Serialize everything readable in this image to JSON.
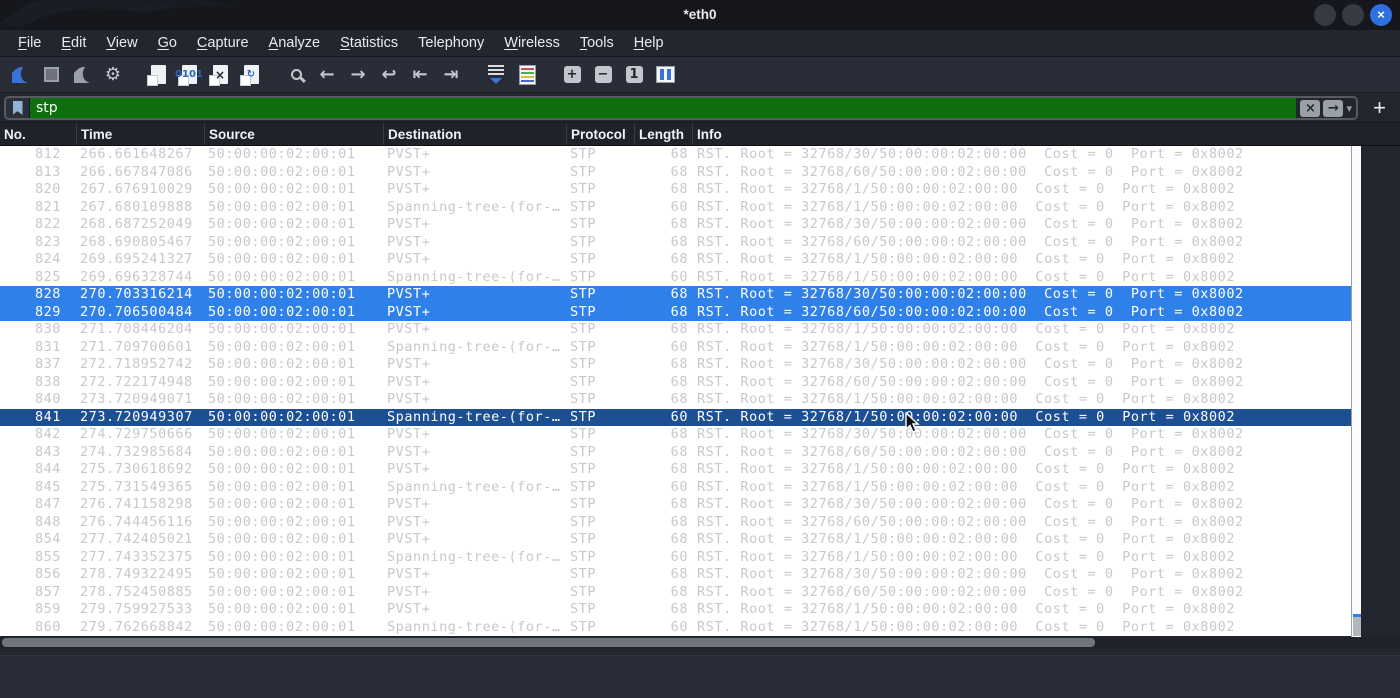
{
  "window": {
    "title": "*eth0"
  },
  "menu": {
    "items": [
      {
        "label": "File",
        "mnemonic": true
      },
      {
        "label": "Edit",
        "mnemonic": true
      },
      {
        "label": "View",
        "mnemonic": true
      },
      {
        "label": "Go",
        "mnemonic": true
      },
      {
        "label": "Capture",
        "mnemonic": true
      },
      {
        "label": "Analyze",
        "mnemonic": true
      },
      {
        "label": "Statistics",
        "mnemonic": true
      },
      {
        "label": "Telephony",
        "mnemonic": false
      },
      {
        "label": "Wireless",
        "mnemonic": true
      },
      {
        "label": "Tools",
        "mnemonic": true
      },
      {
        "label": "Help",
        "mnemonic": true
      }
    ]
  },
  "toolbar": {
    "groups": [
      [
        {
          "name": "start-capture-icon",
          "kind": "finblue"
        },
        {
          "name": "stop-capture-icon",
          "kind": "stop"
        },
        {
          "name": "restart-capture-icon",
          "kind": "fingray"
        },
        {
          "name": "capture-options-icon",
          "kind": "glyph",
          "glyph": "⚙"
        }
      ],
      [
        {
          "name": "open-file-icon",
          "kind": "doc",
          "overlay": ""
        },
        {
          "name": "save-file-icon",
          "kind": "doc",
          "overlay": "0101"
        },
        {
          "name": "close-file-icon",
          "kind": "doc",
          "overlay": "×",
          "dark": true
        },
        {
          "name": "reload-file-icon",
          "kind": "doc",
          "overlay": "↻"
        }
      ],
      [
        {
          "name": "find-packet-icon",
          "kind": "magnifier"
        },
        {
          "name": "go-back-icon",
          "kind": "glyph",
          "glyph": "←"
        },
        {
          "name": "go-forward-icon",
          "kind": "glyph",
          "glyph": "→"
        },
        {
          "name": "go-to-packet-icon",
          "kind": "glyph",
          "glyph": "↩"
        },
        {
          "name": "go-first-packet-icon",
          "kind": "glyph",
          "glyph": "⇤"
        },
        {
          "name": "go-last-packet-icon",
          "kind": "glyph",
          "glyph": "⇥"
        }
      ],
      [
        {
          "name": "auto-scroll-icon",
          "kind": "autoscroll"
        },
        {
          "name": "colorize-icon",
          "kind": "colorize"
        }
      ],
      [
        {
          "name": "zoom-in-icon",
          "kind": "boxglyph",
          "glyph": "+"
        },
        {
          "name": "zoom-out-icon",
          "kind": "boxglyph",
          "glyph": "−"
        },
        {
          "name": "zoom-100-icon",
          "kind": "boxglyph",
          "glyph": "1"
        },
        {
          "name": "resize-columns-icon",
          "kind": "resizecols"
        }
      ]
    ]
  },
  "filter": {
    "value": "stp",
    "clear_glyph": "×",
    "apply_glyph": "→",
    "dropdown_glyph": "▾",
    "add_button": "+"
  },
  "packet_list": {
    "columns": [
      "No.",
      "Time",
      "Source",
      "Destination",
      "Protocol",
      "Length",
      "Info"
    ],
    "packets": [
      {
        "no": "812",
        "time": "266.661648267",
        "source": "50:00:00:02:00:01",
        "destination": "PVST+",
        "protocol": "STP",
        "length": "68",
        "info": "RST. Root = 32768/30/50:00:00:02:00:00  Cost = 0  Port = 0x8002",
        "state": "normal"
      },
      {
        "no": "813",
        "time": "266.667847086",
        "source": "50:00:00:02:00:01",
        "destination": "PVST+",
        "protocol": "STP",
        "length": "68",
        "info": "RST. Root = 32768/60/50:00:00:02:00:00  Cost = 0  Port = 0x8002",
        "state": "normal"
      },
      {
        "no": "820",
        "time": "267.676910029",
        "source": "50:00:00:02:00:01",
        "destination": "PVST+",
        "protocol": "STP",
        "length": "68",
        "info": "RST. Root = 32768/1/50:00:00:02:00:00  Cost = 0  Port = 0x8002",
        "state": "normal"
      },
      {
        "no": "821",
        "time": "267.680109888",
        "source": "50:00:00:02:00:01",
        "destination": "Spanning-tree-(for-…",
        "protocol": "STP",
        "length": "60",
        "info": "RST. Root = 32768/1/50:00:00:02:00:00  Cost = 0  Port = 0x8002",
        "state": "normal"
      },
      {
        "no": "822",
        "time": "268.687252049",
        "source": "50:00:00:02:00:01",
        "destination": "PVST+",
        "protocol": "STP",
        "length": "68",
        "info": "RST. Root = 32768/30/50:00:00:02:00:00  Cost = 0  Port = 0x8002",
        "state": "normal"
      },
      {
        "no": "823",
        "time": "268.690805467",
        "source": "50:00:00:02:00:01",
        "destination": "PVST+",
        "protocol": "STP",
        "length": "68",
        "info": "RST. Root = 32768/60/50:00:00:02:00:00  Cost = 0  Port = 0x8002",
        "state": "normal"
      },
      {
        "no": "824",
        "time": "269.695241327",
        "source": "50:00:00:02:00:01",
        "destination": "PVST+",
        "protocol": "STP",
        "length": "68",
        "info": "RST. Root = 32768/1/50:00:00:02:00:00  Cost = 0  Port = 0x8002",
        "state": "normal"
      },
      {
        "no": "825",
        "time": "269.696328744",
        "source": "50:00:00:02:00:01",
        "destination": "Spanning-tree-(for-…",
        "protocol": "STP",
        "length": "60",
        "info": "RST. Root = 32768/1/50:00:00:02:00:00  Cost = 0  Port = 0x8002",
        "state": "normal"
      },
      {
        "no": "828",
        "time": "270.703316214",
        "source": "50:00:00:02:00:01",
        "destination": "PVST+",
        "protocol": "STP",
        "length": "68",
        "info": "RST. Root = 32768/30/50:00:00:02:00:00  Cost = 0  Port = 0x8002",
        "state": "selected"
      },
      {
        "no": "829",
        "time": "270.706500484",
        "source": "50:00:00:02:00:01",
        "destination": "PVST+",
        "protocol": "STP",
        "length": "68",
        "info": "RST. Root = 32768/60/50:00:00:02:00:00  Cost = 0  Port = 0x8002",
        "state": "selected"
      },
      {
        "no": "830",
        "time": "271.708446204",
        "source": "50:00:00:02:00:01",
        "destination": "PVST+",
        "protocol": "STP",
        "length": "68",
        "info": "RST. Root = 32768/1/50:00:00:02:00:00  Cost = 0  Port = 0x8002",
        "state": "normal"
      },
      {
        "no": "831",
        "time": "271.709700601",
        "source": "50:00:00:02:00:01",
        "destination": "Spanning-tree-(for-…",
        "protocol": "STP",
        "length": "60",
        "info": "RST. Root = 32768/1/50:00:00:02:00:00  Cost = 0  Port = 0x8002",
        "state": "normal"
      },
      {
        "no": "837",
        "time": "272.718952742",
        "source": "50:00:00:02:00:01",
        "destination": "PVST+",
        "protocol": "STP",
        "length": "68",
        "info": "RST. Root = 32768/30/50:00:00:02:00:00  Cost = 0  Port = 0x8002",
        "state": "normal"
      },
      {
        "no": "838",
        "time": "272.722174948",
        "source": "50:00:00:02:00:01",
        "destination": "PVST+",
        "protocol": "STP",
        "length": "68",
        "info": "RST. Root = 32768/60/50:00:00:02:00:00  Cost = 0  Port = 0x8002",
        "state": "normal"
      },
      {
        "no": "840",
        "time": "273.720949071",
        "source": "50:00:00:02:00:01",
        "destination": "PVST+",
        "protocol": "STP",
        "length": "68",
        "info": "RST. Root = 32768/1/50:00:00:02:00:00  Cost = 0  Port = 0x8002",
        "state": "normal"
      },
      {
        "no": "841",
        "time": "273.720949307",
        "source": "50:00:00:02:00:01",
        "destination": "Spanning-tree-(for-…",
        "protocol": "STP",
        "length": "60",
        "info": "RST. Root = 32768/1/50:00:00:02:00:00  Cost = 0  Port = 0x8002",
        "state": "focused"
      },
      {
        "no": "842",
        "time": "274.729750666",
        "source": "50:00:00:02:00:01",
        "destination": "PVST+",
        "protocol": "STP",
        "length": "68",
        "info": "RST. Root = 32768/30/50:00:00:02:00:00  Cost = 0  Port = 0x8002",
        "state": "normal"
      },
      {
        "no": "843",
        "time": "274.732985684",
        "source": "50:00:00:02:00:01",
        "destination": "PVST+",
        "protocol": "STP",
        "length": "68",
        "info": "RST. Root = 32768/60/50:00:00:02:00:00  Cost = 0  Port = 0x8002",
        "state": "normal"
      },
      {
        "no": "844",
        "time": "275.730618692",
        "source": "50:00:00:02:00:01",
        "destination": "PVST+",
        "protocol": "STP",
        "length": "68",
        "info": "RST. Root = 32768/1/50:00:00:02:00:00  Cost = 0  Port = 0x8002",
        "state": "normal"
      },
      {
        "no": "845",
        "time": "275.731549365",
        "source": "50:00:00:02:00:01",
        "destination": "Spanning-tree-(for-…",
        "protocol": "STP",
        "length": "60",
        "info": "RST. Root = 32768/1/50:00:00:02:00:00  Cost = 0  Port = 0x8002",
        "state": "normal"
      },
      {
        "no": "847",
        "time": "276.741158298",
        "source": "50:00:00:02:00:01",
        "destination": "PVST+",
        "protocol": "STP",
        "length": "68",
        "info": "RST. Root = 32768/30/50:00:00:02:00:00  Cost = 0  Port = 0x8002",
        "state": "normal"
      },
      {
        "no": "848",
        "time": "276.744456116",
        "source": "50:00:00:02:00:01",
        "destination": "PVST+",
        "protocol": "STP",
        "length": "68",
        "info": "RST. Root = 32768/60/50:00:00:02:00:00  Cost = 0  Port = 0x8002",
        "state": "normal"
      },
      {
        "no": "854",
        "time": "277.742405021",
        "source": "50:00:00:02:00:01",
        "destination": "PVST+",
        "protocol": "STP",
        "length": "68",
        "info": "RST. Root = 32768/1/50:00:00:02:00:00  Cost = 0  Port = 0x8002",
        "state": "normal"
      },
      {
        "no": "855",
        "time": "277.743352375",
        "source": "50:00:00:02:00:01",
        "destination": "Spanning-tree-(for-…",
        "protocol": "STP",
        "length": "60",
        "info": "RST. Root = 32768/1/50:00:00:02:00:00  Cost = 0  Port = 0x8002",
        "state": "normal"
      },
      {
        "no": "856",
        "time": "278.749322495",
        "source": "50:00:00:02:00:01",
        "destination": "PVST+",
        "protocol": "STP",
        "length": "68",
        "info": "RST. Root = 32768/30/50:00:00:02:00:00  Cost = 0  Port = 0x8002",
        "state": "normal"
      },
      {
        "no": "857",
        "time": "278.752450885",
        "source": "50:00:00:02:00:01",
        "destination": "PVST+",
        "protocol": "STP",
        "length": "68",
        "info": "RST. Root = 32768/60/50:00:00:02:00:00  Cost = 0  Port = 0x8002",
        "state": "normal"
      },
      {
        "no": "859",
        "time": "279.759927533",
        "source": "50:00:00:02:00:01",
        "destination": "PVST+",
        "protocol": "STP",
        "length": "68",
        "info": "RST. Root = 32768/1/50:00:00:02:00:00  Cost = 0  Port = 0x8002",
        "state": "normal"
      },
      {
        "no": "860",
        "time": "279.762668842",
        "source": "50:00:00:02:00:01",
        "destination": "Spanning-tree-(for-…",
        "protocol": "STP",
        "length": "60",
        "info": "RST. Root = 32768/1/50:00:00:02:00:00  Cost = 0  Port = 0x8002",
        "state": "normal"
      }
    ]
  },
  "splitter_dots": "·····",
  "colors": {
    "selection_blue": "#2f80e8",
    "selection_navy": "#1d4f93",
    "filter_valid_green": "#0e6f0e",
    "row_text_gray": "#c6c9cc",
    "close_button_blue": "#2f6fe0",
    "titlebar": "#15171d",
    "chrome_dark": "#23262e"
  }
}
